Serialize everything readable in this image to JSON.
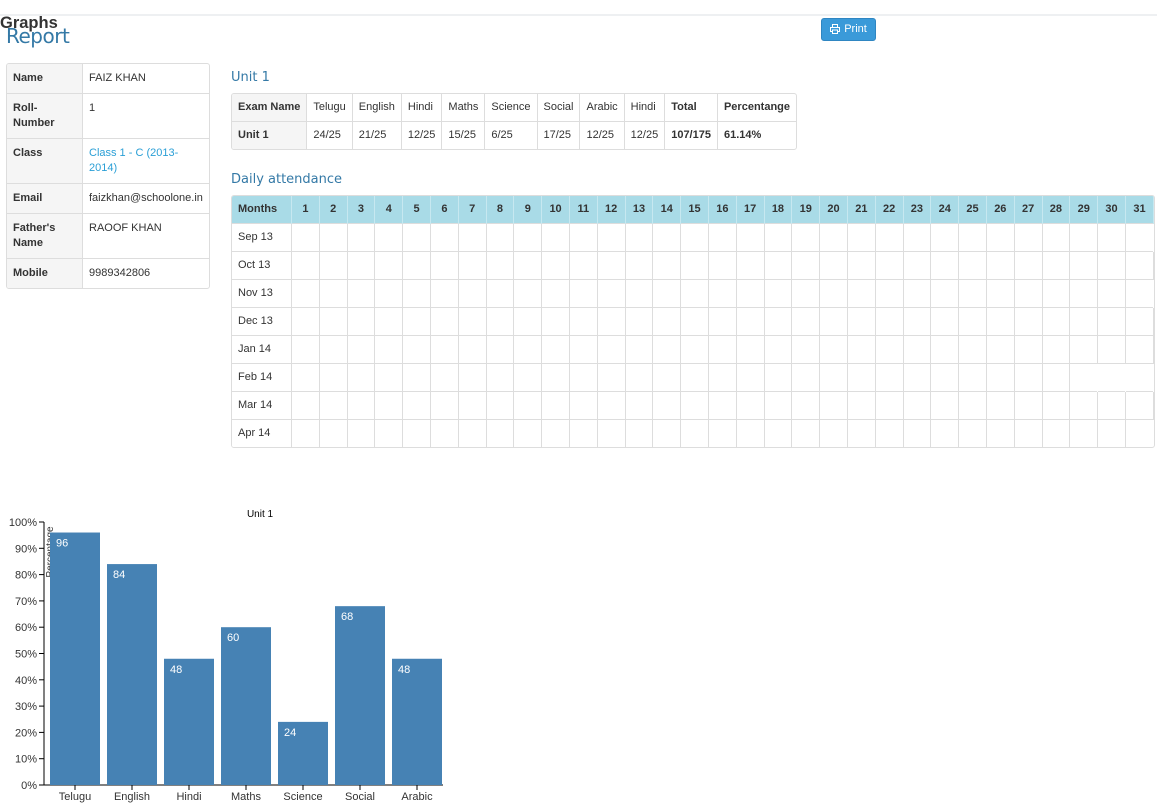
{
  "page": {
    "title": "Report",
    "print_label": "Print",
    "graphs_title": "Graphs"
  },
  "profile": [
    {
      "key": "Name",
      "value": "FAIZ KHAN",
      "link": false
    },
    {
      "key": "Roll-Number",
      "value": "1",
      "link": false
    },
    {
      "key": "Class",
      "value": "Class 1 - C (2013-2014)",
      "link": true
    },
    {
      "key": "Email",
      "value": "faizkhan@schoolone.in",
      "link": false
    },
    {
      "key": "Father's Name",
      "value": "RAOOF KHAN",
      "link": false
    },
    {
      "key": "Mobile",
      "value": "9989342806",
      "link": false
    }
  ],
  "unit": {
    "title": "Unit 1",
    "headers": [
      "Exam Name",
      "Telugu",
      "English",
      "Hindi",
      "Maths",
      "Science",
      "Social",
      "Arabic",
      "Hindi",
      "Total",
      "Percentange"
    ],
    "row": [
      "Unit 1",
      "24/25",
      "21/25",
      "12/25",
      "15/25",
      "6/25",
      "17/25",
      "12/25",
      "12/25",
      "107/175",
      "61.14%"
    ]
  },
  "attendance": {
    "title": "Daily attendance",
    "months_label": "Months",
    "days": [
      "1",
      "2",
      "3",
      "4",
      "5",
      "6",
      "7",
      "8",
      "9",
      "10",
      "11",
      "12",
      "13",
      "14",
      "15",
      "16",
      "17",
      "18",
      "19",
      "20",
      "21",
      "22",
      "23",
      "24",
      "25",
      "26",
      "27",
      "28",
      "29",
      "30",
      "31"
    ],
    "months": [
      {
        "label": "Sep 13",
        "days_in_month": 30
      },
      {
        "label": "Oct 13",
        "days_in_month": 31
      },
      {
        "label": "Nov 13",
        "days_in_month": 30
      },
      {
        "label": "Dec 13",
        "days_in_month": 31
      },
      {
        "label": "Jan 14",
        "days_in_month": 31
      },
      {
        "label": "Feb 14",
        "days_in_month": 28
      },
      {
        "label": "Mar 14",
        "days_in_month": 31
      },
      {
        "label": "Apr 14",
        "days_in_month": 30
      }
    ]
  },
  "chart_data": {
    "type": "bar",
    "title": "Unit 1",
    "ylabel": "Percentage",
    "categories": [
      "Telugu",
      "English",
      "Hindi",
      "Maths",
      "Science",
      "Social",
      "Arabic"
    ],
    "values": [
      96,
      84,
      48,
      60,
      24,
      68,
      48
    ],
    "yticks": [
      "0%",
      "10%",
      "20%",
      "30%",
      "40%",
      "50%",
      "60%",
      "70%",
      "80%",
      "90%",
      "100%"
    ],
    "ylim": [
      0,
      100
    ],
    "bar_color": "#4682b4",
    "grid": false
  }
}
